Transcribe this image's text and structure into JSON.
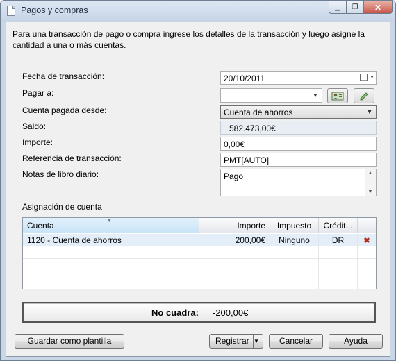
{
  "window": {
    "title": "Pagos y compras",
    "minimize_glyph": "▁",
    "maximize_glyph": "❐",
    "close_glyph": "✕"
  },
  "intro": "Para una transacción de pago o compra ingrese los detalles de la transacción y luego asigne la cantidad a una o más cuentas.",
  "form": {
    "date_label": "Fecha de transacción:",
    "date_value": "20/10/2011",
    "pay_to_label": "Pagar a:",
    "pay_to_value": "",
    "paid_from_label": "Cuenta pagada desde:",
    "paid_from_value": "Cuenta de ahorros",
    "balance_label": "Saldo:",
    "balance_value": "582.473,00€",
    "amount_label": "Importe:",
    "amount_value": "0,00€",
    "reference_label": "Referencia de transacción:",
    "reference_value": "PMT[AUTO]",
    "notes_label": "Notas de libro diario:",
    "notes_value": "Pago"
  },
  "allocation": {
    "title": "Asignación de cuenta",
    "columns": [
      "Cuenta",
      "Importe",
      "Impuesto",
      "Crédit..."
    ],
    "rows": [
      [
        "1120 - Cuenta de ahorros",
        "200,00€",
        "Ninguno",
        "DR"
      ]
    ]
  },
  "balance_bar": {
    "label": "No cuadra:",
    "value": "-200,00€"
  },
  "buttons": {
    "save_template": "Guardar como plantilla",
    "register": "Registrar",
    "cancel": "Cancelar",
    "help": "Ayuda"
  },
  "icons": {
    "document": "document-icon",
    "calendar": "calendar-icon",
    "contact": "contact-card-icon",
    "edit": "edit-pencil-icon",
    "delete": "delete-x-icon"
  },
  "colors": {
    "title_bar": "#c6d4e6",
    "selected_row": "#e4eef9",
    "delete_icon": "#b32d1b"
  }
}
